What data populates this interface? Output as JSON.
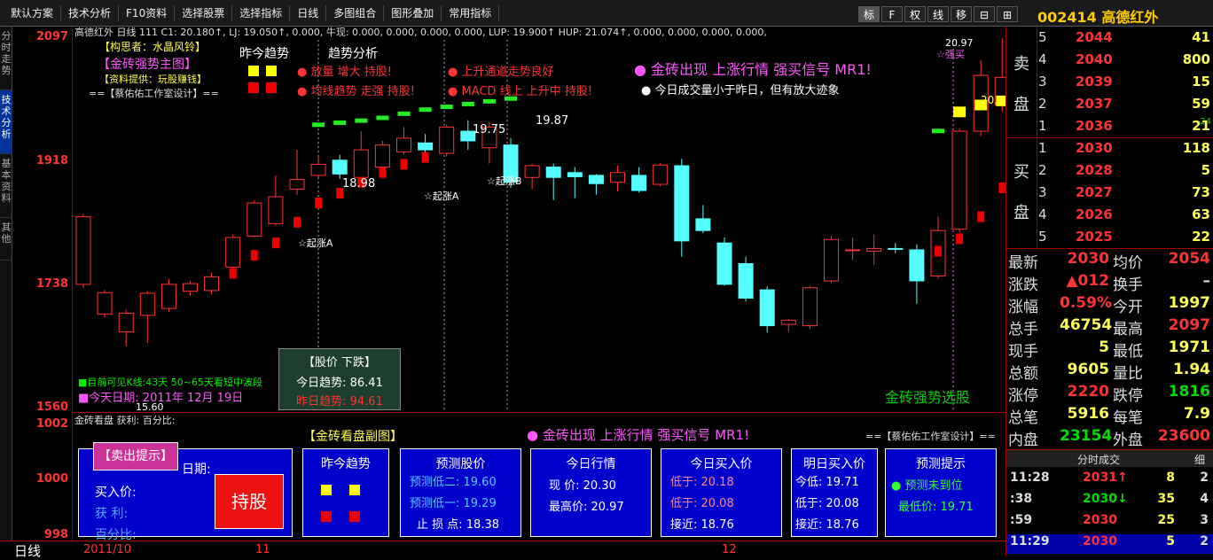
{
  "toolbar": {
    "items": [
      "默认方案",
      "技术分析",
      "F10资料",
      "选择股票",
      "选择指标",
      "日线",
      "多图组合",
      "图形叠加",
      "常用指标"
    ],
    "right_buttons": [
      "标",
      "F",
      "权",
      "线",
      "移",
      "⊟",
      "⊞"
    ],
    "stock_code": "002414",
    "stock_name": "高德红外"
  },
  "sidebar": {
    "tabs": [
      "分时走势",
      "技术分析",
      "基本资料",
      "其他"
    ]
  },
  "axis": {
    "labels": [
      "2097",
      "1918",
      "1738",
      "1560"
    ],
    "sub_labels": [
      "1002",
      "1000",
      "998"
    ]
  },
  "main": {
    "info_line1": "高德红外 日线 111 C1: 20.180↑, LJ: 19.050↑, 0.000, 牛现: 0.000, 0.000, 0.000, 0.000, LUP: 19.900↑ HUP: 21.074↑, 0.000, 0.000, 0.000, 0.000,",
    "author": "【构思者：水晶风铃】",
    "title": "【金砖强势主图】",
    "provider": "【资料提供：玩股赚钱】",
    "designer": "==【蔡佑佑工作室设计】==",
    "legend_a": "昨今趋势",
    "legend_b": "趋势分析",
    "ann1": "● 放量  增大  持股!",
    "ann2": "● 均线趋势  走强  持股!",
    "ann3": "● 上升通道走势良好",
    "ann4": "● MACD  线上  上升中  持股!",
    "signal": "● 金砖出现  上涨行情  强买信号  MR1!",
    "volume_note": "● 今日成交量小于昨日，但有放大迹象",
    "price_labels": [
      "19.75",
      "19.87",
      "18.98",
      "15.60",
      "20.97",
      "20.1"
    ],
    "start_labels": [
      "☆起涨A",
      "☆起涨A",
      "☆起涨B",
      "☆强买"
    ],
    "wave": "■目前可见K线:43天  50~65天看短中波段",
    "date_line": "■今天日期: 2011年 12月 19日",
    "strong_label": "金砖强势选股",
    "alert_title": "【股价 下跌】",
    "alert_row1": "今日趋势: 86.41",
    "alert_row2": "昨日趋势: 94.61"
  },
  "sub": {
    "info": "金砖看盘  获利: 百分比:",
    "title": "【金砖看盘副图】",
    "signal": "● 金砖出现  上涨行情  强买信号  MR1!",
    "designer": "==【蔡佑佑工作室设计】==",
    "panel1": {
      "btn": "【卖出提示】",
      "date_label": "日期:",
      "buy_price": "买入价:",
      "profit": "获  利:",
      "percent": "百分比:",
      "hold": "持股"
    },
    "panel2": {
      "title": "昨今趋势"
    },
    "panel3": {
      "title": "预测股价",
      "row1": "预测低二: 19.60",
      "row2": "预测低一: 19.29",
      "row3": "止 损 点: 18.38"
    },
    "panel4": {
      "title": "今日行情",
      "row1": "现  价: 20.30",
      "row2": "最高价: 20.97"
    },
    "panel5": {
      "title": "今日买入价",
      "row1": "低于: 20.18",
      "row2": "低于: 20.08",
      "row3": "接近: 18.76"
    },
    "panel6": {
      "title": "明日买入价",
      "row1": "今低: 19.71",
      "row2": "低于: 20.08",
      "row3": "接近: 18.76"
    },
    "panel7": {
      "title": "预测提示",
      "row1": "● 预测未到位",
      "row2": "最低价: 19.71"
    }
  },
  "bottom": {
    "period": "日线",
    "dates": [
      "2011/10",
      "11",
      "12"
    ]
  },
  "orderbook": {
    "sell_label": [
      "卖",
      "盘"
    ],
    "buy_label": [
      "买",
      "盘"
    ],
    "sell": [
      {
        "lvl": "5",
        "price": "2044",
        "vol": "41"
      },
      {
        "lvl": "4",
        "price": "2040",
        "vol": "800"
      },
      {
        "lvl": "3",
        "price": "2039",
        "vol": "15"
      },
      {
        "lvl": "2",
        "price": "2037",
        "vol": "59"
      },
      {
        "lvl": "1",
        "price": "2036",
        "vol": "21"
      }
    ],
    "buy": [
      {
        "lvl": "1",
        "price": "2030",
        "vol": "118"
      },
      {
        "lvl": "2",
        "price": "2028",
        "vol": "5"
      },
      {
        "lvl": "3",
        "price": "2027",
        "vol": "73"
      },
      {
        "lvl": "4",
        "price": "2026",
        "vol": "63"
      },
      {
        "lvl": "5",
        "price": "2025",
        "vol": "22"
      }
    ],
    "side_note": "-24"
  },
  "quote": [
    {
      "l1": "最新",
      "v1": "2030",
      "c1": "#ff3333",
      "l2": "均价",
      "v2": "2054",
      "c2": "#ff3333"
    },
    {
      "l1": "涨跌",
      "v1": "▲012",
      "c1": "#ff3333",
      "l2": "换手",
      "v2": "–",
      "c2": "#dddddd"
    },
    {
      "l1": "涨幅",
      "v1": "0.59%",
      "c1": "#ff3333",
      "l2": "今开",
      "v2": "1997",
      "c2": "#ffff55"
    },
    {
      "l1": "总手",
      "v1": "46754",
      "c1": "#ffff55",
      "l2": "最高",
      "v2": "2097",
      "c2": "#ff3333"
    },
    {
      "l1": "现手",
      "v1": "5",
      "c1": "#ffff55",
      "l2": "最低",
      "v2": "1971",
      "c2": "#ffff55"
    },
    {
      "l1": "总额",
      "v1": "9605",
      "c1": "#ffff55",
      "l2": "量比",
      "v2": "1.94",
      "c2": "#ffff55"
    },
    {
      "l1": "涨停",
      "v1": "2220",
      "c1": "#ff3333",
      "l2": "跌停",
      "v2": "1816",
      "c2": "#00dd00"
    },
    {
      "l1": "总笔",
      "v1": "5916",
      "c1": "#ffff55",
      "l2": "每笔",
      "v2": "7.9",
      "c2": "#ffff55"
    },
    {
      "l1": "内盘",
      "v1": "23154",
      "c1": "#00dd00",
      "l2": "外盘",
      "v2": "23600",
      "c2": "#ff3333"
    }
  ],
  "ticks": {
    "tab": "分时成交",
    "tab2": "细",
    "rows": [
      {
        "time": "11:28",
        "price": "2031↑",
        "vol": "8",
        "n": "2",
        "pc": "#ff3333"
      },
      {
        "time": ":38",
        "price": "2030↓",
        "vol": "35",
        "n": "4",
        "pc": "#00dd00"
      },
      {
        "time": ":59",
        "price": "2030",
        "vol": "25",
        "n": "3",
        "pc": "#ff3333"
      },
      {
        "time": "11:29",
        "price": "2030",
        "vol": "5",
        "n": "2",
        "pc": "#ff3333"
      }
    ]
  },
  "candles": [
    {
      "o": 1740,
      "c": 1838,
      "h": 1842,
      "l": 1735
    },
    {
      "o": 1697,
      "c": 1728,
      "h": 1732,
      "l": 1692
    },
    {
      "o": 1671,
      "c": 1698,
      "h": 1703,
      "l": 1650
    },
    {
      "o": 1695,
      "c": 1727,
      "h": 1730,
      "l": 1655
    },
    {
      "o": 1705,
      "c": 1740,
      "h": 1748,
      "l": 1700
    },
    {
      "o": 1730,
      "c": 1741,
      "h": 1745,
      "l": 1724
    },
    {
      "o": 1731,
      "c": 1751,
      "h": 1757,
      "l": 1725
    },
    {
      "o": 1765,
      "c": 1808,
      "h": 1812,
      "l": 1760
    },
    {
      "o": 1810,
      "c": 1858,
      "h": 1862,
      "l": 1808
    },
    {
      "o": 1828,
      "c": 1867,
      "h": 1898,
      "l": 1825
    },
    {
      "o": 1878,
      "c": 1892,
      "h": 1935,
      "l": 1870
    },
    {
      "o": 1898,
      "c": 1914,
      "h": 1925,
      "l": 1895
    },
    {
      "o": 1920,
      "c": 1900,
      "h": 1928,
      "l": 1893
    },
    {
      "o": 1895,
      "c": 1935,
      "h": 1962,
      "l": 1888
    },
    {
      "o": 1910,
      "c": 1942,
      "h": 1948,
      "l": 1906
    },
    {
      "o": 1932,
      "c": 1952,
      "h": 1968,
      "l": 1928
    },
    {
      "o": 1945,
      "c": 1935,
      "h": 1958,
      "l": 1922
    },
    {
      "o": 1930,
      "c": 1968,
      "h": 1972,
      "l": 1925
    },
    {
      "o": 1962,
      "c": 1948,
      "h": 1978,
      "l": 1935
    },
    {
      "o": 1938,
      "c": 1968,
      "h": 1976,
      "l": 1915
    },
    {
      "o": 1942,
      "c": 1888,
      "h": 1952,
      "l": 1880
    },
    {
      "o": 1895,
      "c": 1912,
      "h": 1915,
      "l": 1878
    },
    {
      "o": 1910,
      "c": 1895,
      "h": 1915,
      "l": 1862
    },
    {
      "o": 1902,
      "c": 1896,
      "h": 1910,
      "l": 1865
    },
    {
      "o": 1898,
      "c": 1886,
      "h": 1900,
      "l": 1870
    },
    {
      "o": 1888,
      "c": 1902,
      "h": 1912,
      "l": 1875
    },
    {
      "o": 1898,
      "c": 1876,
      "h": 1910,
      "l": 1873
    },
    {
      "o": 1885,
      "c": 1913,
      "h": 1916,
      "l": 1882
    },
    {
      "o": 1912,
      "c": 1803,
      "h": 1922,
      "l": 1780
    },
    {
      "o": 1835,
      "c": 1818,
      "h": 1855,
      "l": 1814
    },
    {
      "o": 1800,
      "c": 1740,
      "h": 1808,
      "l": 1738
    },
    {
      "o": 1770,
      "c": 1720,
      "h": 1780,
      "l": 1715
    },
    {
      "o": 1732,
      "c": 1680,
      "h": 1737,
      "l": 1670
    },
    {
      "o": 1682,
      "c": 1688,
      "h": 1690,
      "l": 1672
    },
    {
      "o": 1680,
      "c": 1735,
      "h": 1738,
      "l": 1675
    },
    {
      "o": 1745,
      "c": 1805,
      "h": 1810,
      "l": 1742
    },
    {
      "o": 1790,
      "c": 1790,
      "h": 1808,
      "l": 1775
    },
    {
      "o": 1788,
      "c": 1792,
      "h": 1812,
      "l": 1768
    },
    {
      "o": 1792,
      "c": 1791,
      "h": 1800,
      "l": 1785
    },
    {
      "o": 1790,
      "c": 1745,
      "h": 1798,
      "l": 1712
    },
    {
      "o": 1752,
      "c": 1818,
      "h": 1838,
      "l": 1748
    },
    {
      "o": 1820,
      "c": 1962,
      "h": 1966,
      "l": 1815
    },
    {
      "o": 1962,
      "c": 2043,
      "h": 2065,
      "l": 1955
    },
    {
      "o": 2000,
      "c": 2040,
      "h": 2097,
      "l": 1990
    }
  ],
  "dots_red": [
    {
      "i": 7,
      "v": 1756
    },
    {
      "i": 8,
      "v": 1782
    },
    {
      "i": 9,
      "v": 1800
    },
    {
      "i": 10,
      "v": 1830
    },
    {
      "i": 11,
      "v": 1858
    },
    {
      "i": 12,
      "v": 1872
    },
    {
      "i": 13,
      "v": 1888
    },
    {
      "i": 14,
      "v": 1902
    },
    {
      "i": 15,
      "v": 1914
    },
    {
      "i": 16,
      "v": 1924
    },
    {
      "i": 40,
      "v": 1788
    },
    {
      "i": 41,
      "v": 1806
    },
    {
      "i": 42,
      "v": 1838
    },
    {
      "i": 43,
      "v": 1880
    }
  ],
  "dots_yellow": [
    {
      "i": 41,
      "v": 1990
    },
    {
      "i": 42,
      "v": 2000
    },
    {
      "i": 43,
      "v": 2006
    }
  ],
  "dashes_green": [
    {
      "i": 11,
      "v": 1972
    },
    {
      "i": 12,
      "v": 1975
    },
    {
      "i": 13,
      "v": 1978
    },
    {
      "i": 14,
      "v": 1982
    },
    {
      "i": 15,
      "v": 1988
    },
    {
      "i": 16,
      "v": 1994
    },
    {
      "i": 17,
      "v": 1998
    },
    {
      "i": 18,
      "v": 2002
    },
    {
      "i": 19,
      "v": 2006
    },
    {
      "i": 20,
      "v": 2010
    },
    {
      "i": 40,
      "v": 1963
    }
  ]
}
